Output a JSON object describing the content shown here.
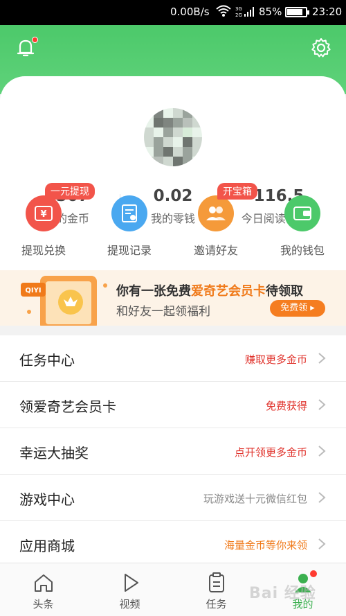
{
  "status_bar": {
    "net_speed": "0.00B/s",
    "battery_pct": "85%",
    "time": "23:20"
  },
  "header": {
    "bell_icon": "bell-icon",
    "settings_icon": "gear-icon"
  },
  "stats": [
    {
      "value": "1307",
      "label": "我的金币"
    },
    {
      "value": "0.02",
      "label": "我的零钱"
    },
    {
      "value": "116.5",
      "label": "今日阅读(分钟)"
    }
  ],
  "quick_actions": [
    {
      "label": "提现兑换",
      "badge": "一元提现",
      "color": "#f2544a",
      "icon": "yen-icon"
    },
    {
      "label": "提现记录",
      "badge": "",
      "color": "#4aa8f0",
      "icon": "record-icon"
    },
    {
      "label": "邀请好友",
      "badge": "开宝箱",
      "color": "#f59a3a",
      "icon": "people-icon"
    },
    {
      "label": "我的钱包",
      "badge": "",
      "color": "#4cc96a",
      "icon": "wallet-icon"
    }
  ],
  "banner": {
    "title_prefix": "你有一张免费",
    "title_highlight": "爱奇艺会员卡",
    "title_suffix": "待领取",
    "subtitle": "和好友一起领福利",
    "button": "免费领 ▸",
    "logo_text": "QIYI"
  },
  "menu": [
    {
      "title": "任务中心",
      "right": "赚取更多金币",
      "color": "#e0322b"
    },
    {
      "title": "领爱奇艺会员卡",
      "right": "免费获得",
      "color": "#e0322b"
    },
    {
      "title": "幸运大抽奖",
      "right": "点开领更多金币",
      "color": "#e0322b"
    },
    {
      "title": "游戏中心",
      "right": "玩游戏送十元微信红包",
      "color": "#888888"
    },
    {
      "title": "应用商城",
      "right": "海量金币等你来领",
      "color": "#f07a1a"
    }
  ],
  "bottom_nav": [
    {
      "label": "头条",
      "icon": "home-icon"
    },
    {
      "label": "视频",
      "icon": "play-icon"
    },
    {
      "label": "任务",
      "icon": "task-icon"
    },
    {
      "label": "我的",
      "icon": "me-icon"
    }
  ],
  "watermark": "Bai 经验",
  "colors": {
    "brand_green": "#4cc96a",
    "accent_red": "#e0322b",
    "accent_orange": "#f07a1a"
  }
}
